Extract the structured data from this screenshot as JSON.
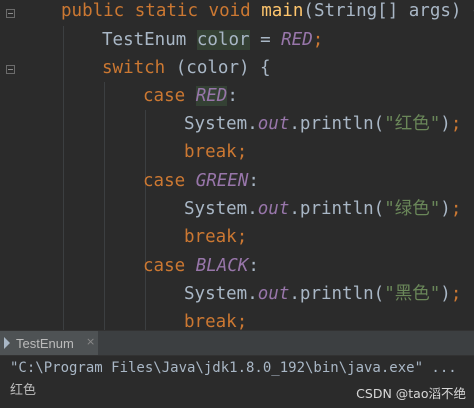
{
  "editor": {
    "line1": {
      "kw1": "public",
      "kw2": "static",
      "kw3": "void",
      "fn": "main",
      "p1": "(",
      "type": "String",
      "arr": "[] ",
      "arg": "args",
      "p2": ") {"
    },
    "line2": {
      "type": "TestEnum",
      "var": "color",
      "eq": " = ",
      "const": "RED",
      "semi": ";"
    },
    "line3": {
      "kw": "switch",
      "p1": " (",
      "var": "color",
      "p2": ") {"
    },
    "line4": {
      "kw": "case",
      "const": "RED",
      "colon": ":"
    },
    "line5": {
      "obj": "System.",
      "field": "out",
      "call": ".println(",
      "str": "\"红色\"",
      "close": ")",
      "semi": ";"
    },
    "line6": {
      "kw": "break",
      "semi": ";"
    },
    "line7": {
      "kw": "case",
      "const": "GREEN",
      "colon": ":"
    },
    "line8": {
      "obj": "System.",
      "field": "out",
      "call": ".println(",
      "str": "\"绿色\"",
      "close": ")",
      "semi": ";"
    },
    "line9": {
      "kw": "break",
      "semi": ";"
    },
    "line10": {
      "kw": "case",
      "const": "BLACK",
      "colon": ":"
    },
    "line11": {
      "obj": "System.",
      "field": "out",
      "call": ".println(",
      "str": "\"黑色\"",
      "close": ")",
      "semi": ";"
    },
    "line12": {
      "kw": "break",
      "semi": ";"
    }
  },
  "run_panel": {
    "tab_label": "TestEnum",
    "tab_close": "×",
    "command": "\"C:\\Program Files\\Java\\jdk1.8.0_192\\bin\\java.exe\" ...",
    "output": "红色"
  },
  "watermark": "CSDN @tao滔不绝",
  "colors": {
    "background": "#2b2b2b",
    "keyword": "#cc7832",
    "method": "#ffc66d",
    "constant": "#9876aa",
    "string": "#6a8759",
    "text": "#a9b7c6"
  }
}
